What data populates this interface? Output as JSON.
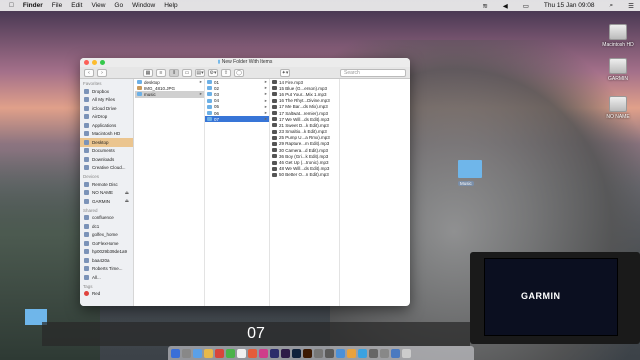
{
  "menubar": {
    "app": "Finder",
    "items": [
      "File",
      "Edit",
      "View",
      "Go",
      "Window",
      "Help"
    ],
    "clock": "Thu 15 Jan 09:08"
  },
  "desktop_icons": [
    {
      "label": "Macintosh HD"
    },
    {
      "label": "GARMIN"
    },
    {
      "label": "NO NAME"
    }
  ],
  "window": {
    "title": "New Folder With Items",
    "search_placeholder": "Search"
  },
  "sidebar": {
    "favorites_header": "Favorites",
    "favorites": [
      "Dropbox",
      "All My Files",
      "iCloud Drive",
      "AirDrop",
      "Applications",
      "Macintosh HD",
      "Desktop",
      "Documents",
      "Downloads",
      "Creative Cloud..."
    ],
    "devices_header": "Devices",
    "devices": [
      "Remote Disc",
      "NO NAME",
      "GARMIN"
    ],
    "shared_header": "Shared",
    "shared": [
      "confluence",
      "dc1",
      "golfex_home",
      "GoFlexHome",
      "hp0029b39de1a9",
      "baa420a",
      "Roberts Time...",
      "All..."
    ],
    "tags_header": "Tags",
    "tags": [
      "Red"
    ]
  },
  "col1": [
    "desktop",
    "IMG_4810.JPG",
    "music"
  ],
  "col2": [
    "01",
    "02",
    "03",
    "04",
    "05",
    "06",
    "07"
  ],
  "col3": [
    "14 Fire.mp3",
    "15 Blue (G...erson).mp3",
    "16 Put Your...Mix 1.mp3",
    "16 The Rhyt...Divine.mp3",
    "17 Me Bar...ds Mix).mp3",
    "17 Saltwat...remier).mp3",
    "17 We Will...ds Edit).mp3",
    "21 Sweet D...k Edit).mp3",
    "23 Smaltio...k Edit).mp3",
    "25 Pump U...a Rmx).mp3",
    "29 Rapture...m Edit).mp3",
    "30 Camera...d Edit).mp3",
    "36 Boy (Gri...k Edit).mp3",
    "46 Get Up (...tronic).mp3",
    "48 We Will...ds Edit).mp3",
    "50 Better O...n Edit).mp3"
  ],
  "desk_folder_label": "Music",
  "overlay_number": "07",
  "garmin_label": "GARMIN"
}
